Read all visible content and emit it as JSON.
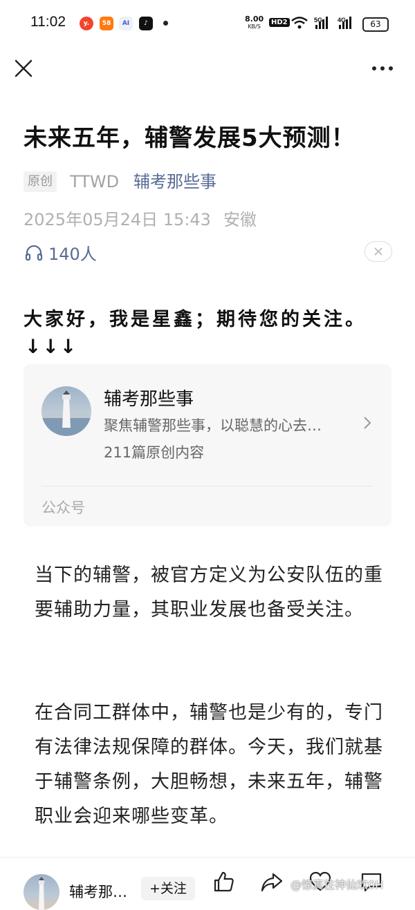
{
  "status_bar": {
    "time": "11:02",
    "app_icons": [
      "toutiao-icon",
      "58-icon",
      "ai-icon",
      "douyin-icon"
    ],
    "app_icon_texts": [
      "y.",
      "58",
      "AI\n28",
      "♪"
    ],
    "net_speed": "8.00",
    "net_speed_unit": "KB/S",
    "hd_label": "HD2",
    "signal_5g": "5G",
    "signal_4g": "4G",
    "battery": "63"
  },
  "article": {
    "title": "未来五年，辅警发展5大预测！",
    "original_tag": "原创",
    "author": "TTWD",
    "account": "辅考那些事",
    "date": "2025年05月24日 15:43",
    "location": "安徽",
    "listen_count": "140人",
    "greeting": "大家好，我是星鑫；期待您的关注。",
    "arrows": "↓↓↓",
    "paragraphs": [
      "当下的辅警，被官方定义为公安队伍的重要辅助力量，其职业发展也备受关注。",
      "在合同工群体中，辅警也是少有的，专门有法律法规保障的群体。今天，我们就基于辅警条例，大胆畅想，未来五年，辅警职业会迎来哪些变革。"
    ]
  },
  "account_card": {
    "name": "辅考那些事",
    "description": "聚焦辅警那些事，以聪慧的心去…",
    "count": "211篇原创内容",
    "type": "公众号"
  },
  "bottom_bar": {
    "name": "辅考那…",
    "follow": "+关注",
    "watermark": "@惊真往神仙欢0H"
  },
  "colors": {
    "link": "#576b95",
    "muted": "#b0b0b0",
    "card_bg": "#f7f7f7"
  }
}
